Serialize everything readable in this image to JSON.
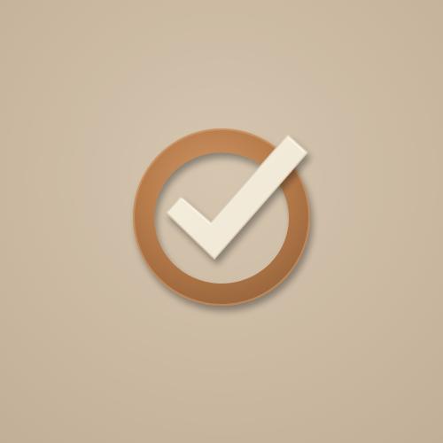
{
  "scene": {
    "background_color": "#cebda7",
    "icon": "checkmark-circle-icon",
    "ring_color": "#b87a48",
    "ring_highlight_color": "#d9a06c",
    "ring_shadow_color": "#8e5a33",
    "check_color": "#efe6d3",
    "check_shadow_color": "#b8aa93"
  }
}
